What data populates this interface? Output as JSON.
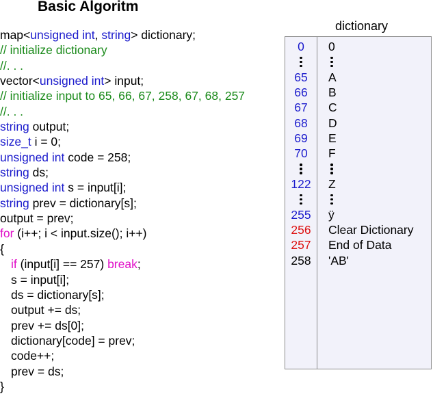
{
  "title": "Basic Algoritm",
  "code_lines": [
    [
      {
        "t": "map<",
        "c": ""
      },
      {
        "t": "unsigned int",
        "c": "kw"
      },
      {
        "t": ", ",
        "c": ""
      },
      {
        "t": "string",
        "c": "kw"
      },
      {
        "t": "> dictionary;",
        "c": ""
      }
    ],
    [
      {
        "t": "// initialize dictionary",
        "c": "cm"
      }
    ],
    [
      {
        "t": "//. . .",
        "c": "cm"
      }
    ],
    [
      {
        "t": "vector<",
        "c": ""
      },
      {
        "t": "unsigned int",
        "c": "kw"
      },
      {
        "t": "> input;",
        "c": ""
      }
    ],
    [
      {
        "t": "// initialize input to 65, 66, 67, 258, 67, 68, 257",
        "c": "cm"
      }
    ],
    [
      {
        "t": "//. . .",
        "c": "cm"
      }
    ],
    [
      {
        "t": "string",
        "c": "kw"
      },
      {
        "t": " output;",
        "c": ""
      }
    ],
    [
      {
        "t": "size_t",
        "c": "kw"
      },
      {
        "t": " i = 0;",
        "c": ""
      }
    ],
    [
      {
        "t": "unsigned int",
        "c": "kw"
      },
      {
        "t": " code = 258;",
        "c": ""
      }
    ],
    [
      {
        "t": "string",
        "c": "kw"
      },
      {
        "t": " ds;",
        "c": ""
      }
    ],
    [
      {
        "t": "unsigned int",
        "c": "kw"
      },
      {
        "t": " s = input[i];",
        "c": ""
      }
    ],
    [
      {
        "t": "string",
        "c": "kw"
      },
      {
        "t": " prev = dictionary[s];",
        "c": ""
      }
    ],
    [
      {
        "t": "output = prev;",
        "c": ""
      }
    ],
    [
      {
        "t": "for",
        "c": "fl"
      },
      {
        "t": " (i++; i < input.size(); i++)",
        "c": ""
      }
    ],
    [
      {
        "t": "{",
        "c": ""
      }
    ],
    [
      {
        "t": "if",
        "c": "fl",
        "indent": true
      },
      {
        "t": " (input[i] == 257) ",
        "c": ""
      },
      {
        "t": "break",
        "c": "fl"
      },
      {
        "t": ";",
        "c": ""
      }
    ],
    [
      {
        "t": "s = input[i];",
        "c": "",
        "indent": true
      }
    ],
    [
      {
        "t": "ds = dictionary[s];",
        "c": "",
        "indent": true
      }
    ],
    [
      {
        "t": "output += ds;",
        "c": "",
        "indent": true
      }
    ],
    [
      {
        "t": "prev += ds[0];",
        "c": "",
        "indent": true
      }
    ],
    [
      {
        "t": "dictionary[code] = prev;",
        "c": "",
        "indent": true
      }
    ],
    [
      {
        "t": "code++;",
        "c": "",
        "indent": true
      }
    ],
    [
      {
        "t": "prev = ds;",
        "c": "",
        "indent": true
      }
    ],
    [
      {
        "t": "}",
        "c": ""
      }
    ]
  ],
  "dictionary": {
    "title": "dictionary",
    "rows": [
      {
        "code": "0",
        "value": "0",
        "color": "blue"
      },
      {
        "dots": true
      },
      {
        "code": "65",
        "value": "A",
        "color": "blue"
      },
      {
        "code": "66",
        "value": "B",
        "color": "blue"
      },
      {
        "code": "67",
        "value": "C",
        "color": "blue"
      },
      {
        "code": "68",
        "value": "D",
        "color": "blue"
      },
      {
        "code": "69",
        "value": "E",
        "color": "blue"
      },
      {
        "code": "70",
        "value": "F",
        "color": "blue"
      },
      {
        "dots": true
      },
      {
        "code": "122",
        "value": "Z",
        "color": "blue"
      },
      {
        "dots": true
      },
      {
        "code": "255",
        "value": "ÿ",
        "color": "blue"
      },
      {
        "code": "256",
        "value": "Clear Dictionary",
        "color": "red"
      },
      {
        "code": "257",
        "value": "End of Data",
        "color": "red"
      },
      {
        "code": "258",
        "value": "'AB'",
        "color": "black"
      }
    ]
  }
}
